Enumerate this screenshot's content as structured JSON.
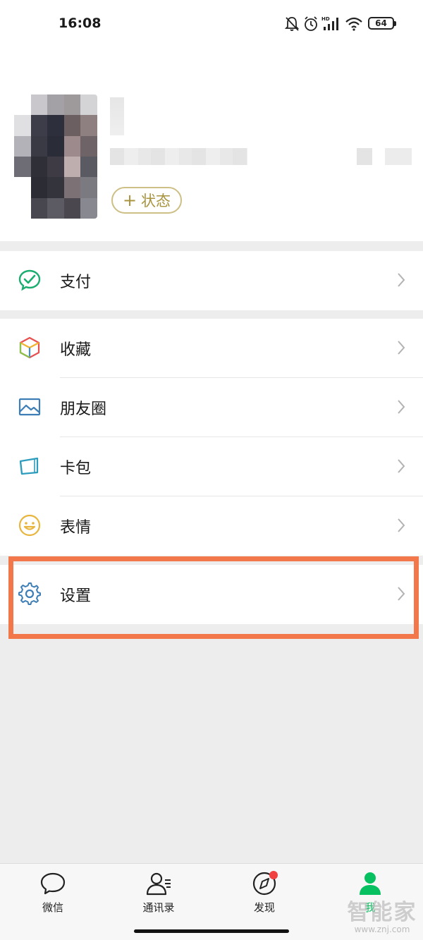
{
  "status_bar": {
    "time": "16:08",
    "network_label": "HD",
    "battery": "64"
  },
  "profile": {
    "status_button": "状态",
    "status_button_plus": "+"
  },
  "menu": {
    "pay": {
      "label": "支付",
      "icon": "pay-check-icon"
    },
    "favorites": {
      "label": "收藏",
      "icon": "cube-icon"
    },
    "moments": {
      "label": "朋友圈",
      "icon": "photo-icon"
    },
    "card_wallet": {
      "label": "卡包",
      "icon": "card-icon"
    },
    "stickers": {
      "label": "表情",
      "icon": "smile-icon"
    },
    "settings": {
      "label": "设置",
      "icon": "gear-icon"
    }
  },
  "tabs": [
    {
      "label": "微信",
      "icon": "chat-bubble-icon"
    },
    {
      "label": "通讯录",
      "icon": "contacts-icon"
    },
    {
      "label": "发现",
      "icon": "compass-icon"
    },
    {
      "label": "我",
      "icon": "person-icon",
      "active": true
    }
  ],
  "watermark": {
    "brand": "智能家",
    "url": "www.znj.com"
  },
  "colors": {
    "accent_green": "#07c160",
    "highlight_orange": "#f2774a",
    "status_gold": "#a8943e",
    "badge_red": "#f04040"
  }
}
